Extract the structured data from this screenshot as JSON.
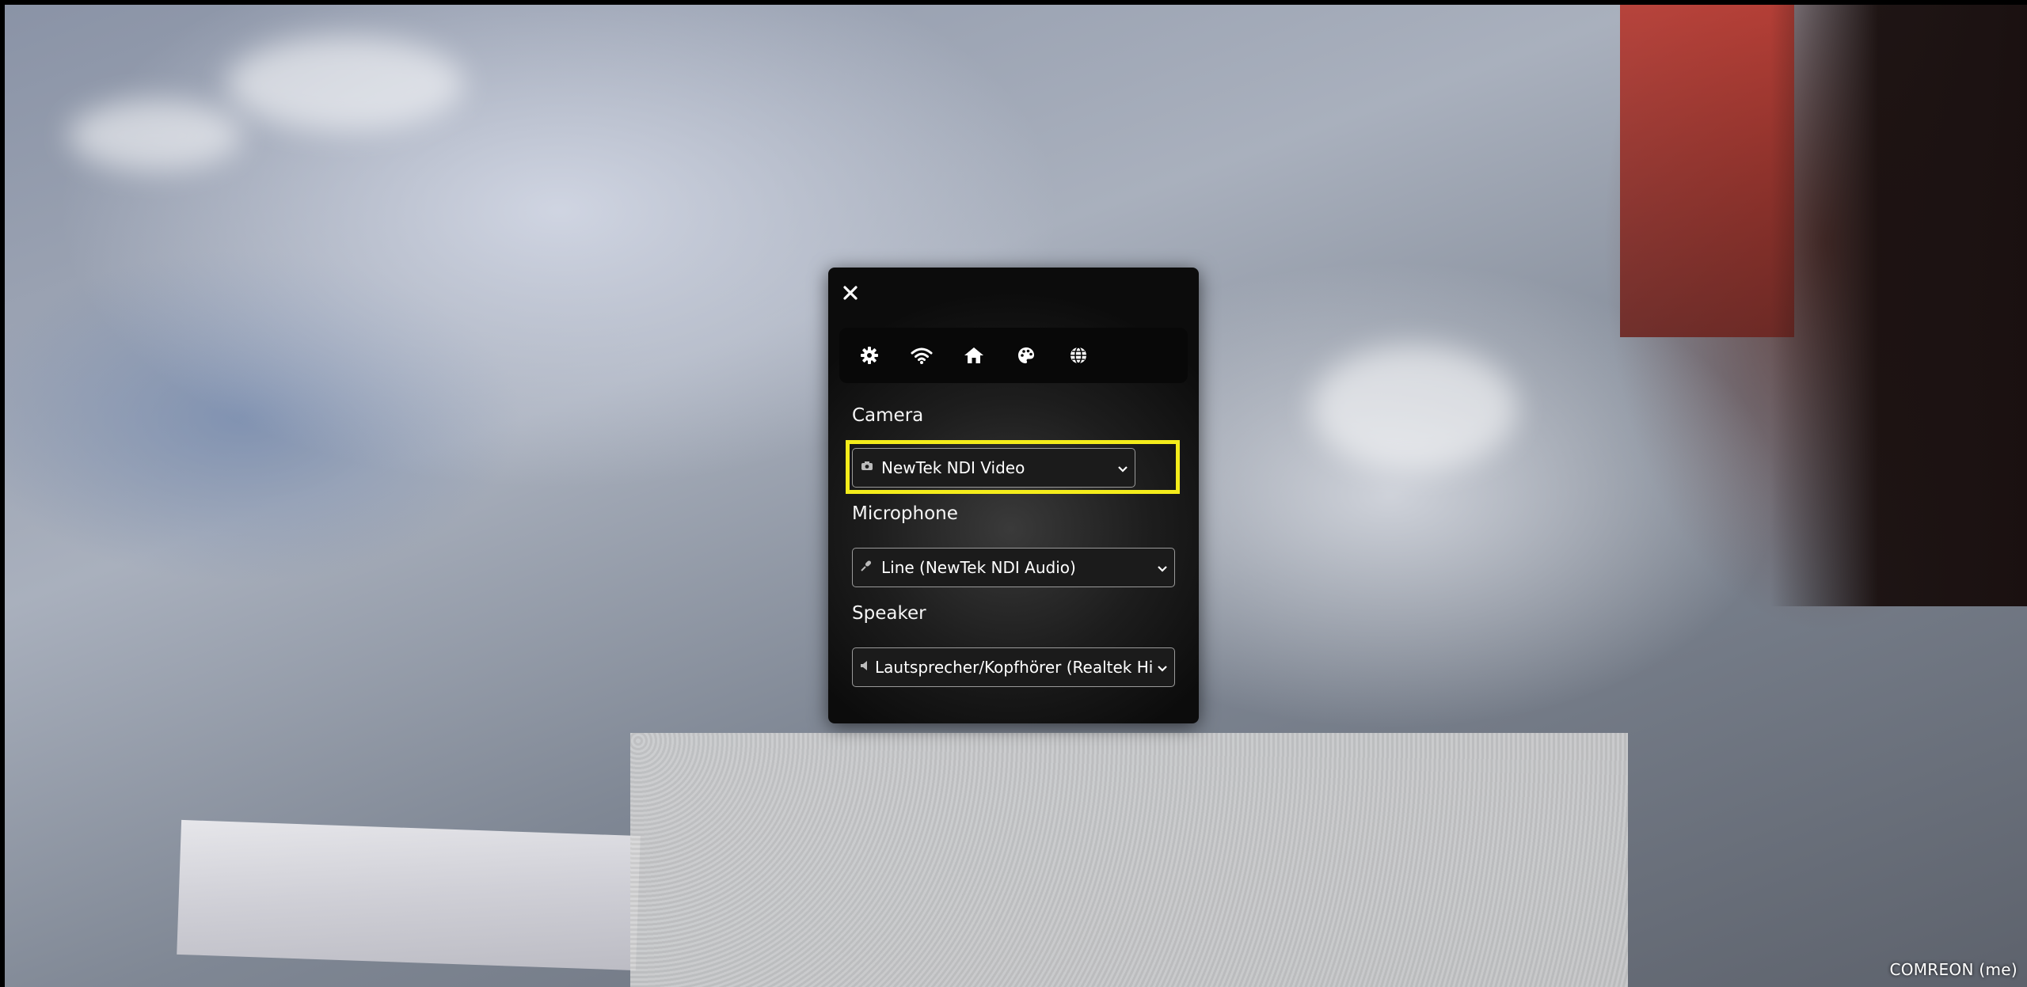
{
  "participant": {
    "name": "COMREON (me)"
  },
  "settings_panel": {
    "close_icon": "close-icon",
    "toolbar_icons": [
      "gear-icon",
      "wifi-icon",
      "home-icon",
      "palette-icon",
      "globe-icon"
    ],
    "camera": {
      "label": "Camera",
      "selected": "NewTek NDI Video",
      "icon": "camera-icon",
      "highlight_color": "#f4ec1b"
    },
    "microphone": {
      "label": "Microphone",
      "selected": "Line (NewTek NDI Audio)",
      "icon": "microphone-icon"
    },
    "speaker": {
      "label": "Speaker",
      "selected": "Lautsprecher/Kopfhörer (Realtek Hi",
      "icon": "speaker-icon"
    }
  }
}
